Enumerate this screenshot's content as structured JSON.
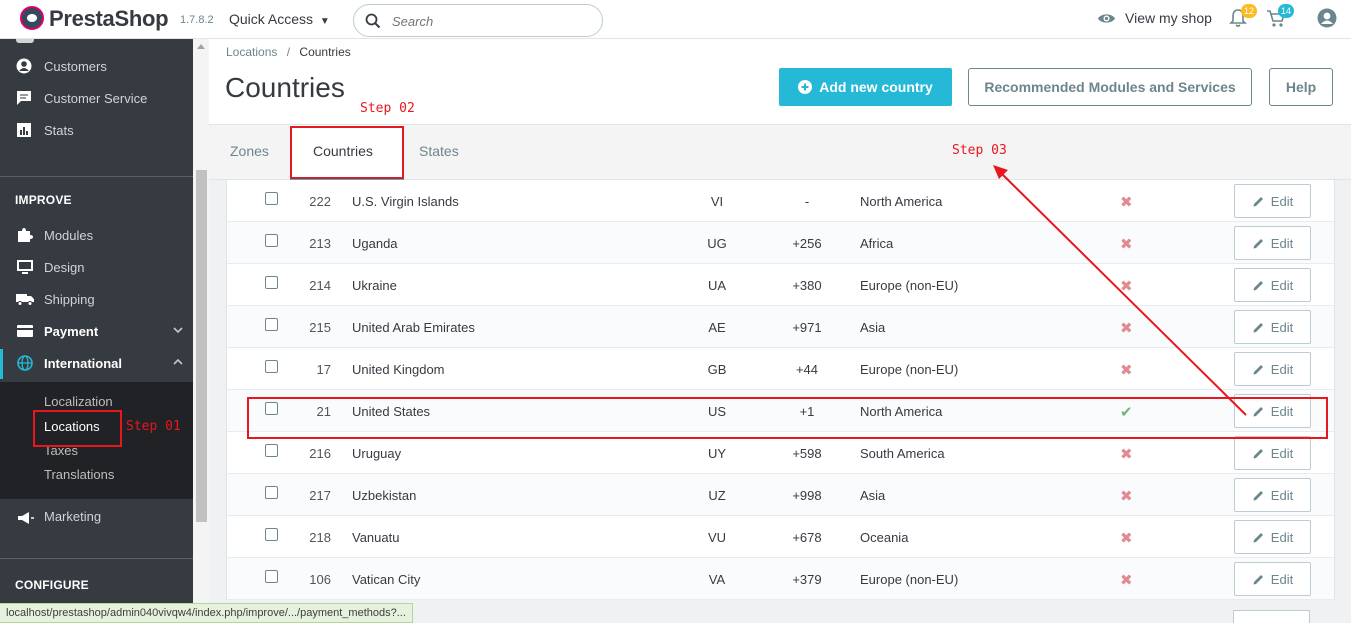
{
  "header": {
    "brand": "PrestaShop",
    "version": "1.7.8.2",
    "quick_access": "Quick Access",
    "search_placeholder": "Search",
    "view_shop": "View my shop",
    "notifications_count": "12",
    "cart_count": "14",
    "colors": {
      "accent": "#25b9d7",
      "badge_orange": "#fbbb22"
    }
  },
  "sidebar": {
    "items_top": [
      {
        "label": "Customers",
        "icon": "customer-icon"
      },
      {
        "label": "Customer Service",
        "icon": "chat-icon"
      },
      {
        "label": "Stats",
        "icon": "stats-icon"
      }
    ],
    "improve_title": "IMPROVE",
    "improve_items": [
      {
        "label": "Modules",
        "icon": "puzzle-icon"
      },
      {
        "label": "Design",
        "icon": "monitor-icon"
      },
      {
        "label": "Shipping",
        "icon": "truck-icon"
      },
      {
        "label": "Payment",
        "icon": "card-icon"
      },
      {
        "label": "International",
        "icon": "globe-icon"
      }
    ],
    "sub_items": [
      "Localization",
      "Locations",
      "Taxes",
      "Translations"
    ],
    "marketing": "Marketing",
    "configure_title": "CONFIGURE"
  },
  "page": {
    "breadcrumb_parent": "Locations",
    "breadcrumb_sep": "/",
    "breadcrumb_current": "Countries",
    "title": "Countries",
    "add_button": "Add new country",
    "recommended_button": "Recommended Modules and Services",
    "help_button": "Help"
  },
  "tabs": [
    "Zones",
    "Countries",
    "States"
  ],
  "table": {
    "edit_label": "Edit",
    "rows": [
      {
        "id": "222",
        "name": "U.S. Virgin Islands",
        "iso": "VI",
        "call": "-",
        "zone": "North America",
        "enabled": false
      },
      {
        "id": "213",
        "name": "Uganda",
        "iso": "UG",
        "call": "+256",
        "zone": "Africa",
        "enabled": false
      },
      {
        "id": "214",
        "name": "Ukraine",
        "iso": "UA",
        "call": "+380",
        "zone": "Europe (non-EU)",
        "enabled": false
      },
      {
        "id": "215",
        "name": "United Arab Emirates",
        "iso": "AE",
        "call": "+971",
        "zone": "Asia",
        "enabled": false
      },
      {
        "id": "17",
        "name": "United Kingdom",
        "iso": "GB",
        "call": "+44",
        "zone": "Europe (non-EU)",
        "enabled": false
      },
      {
        "id": "21",
        "name": "United States",
        "iso": "US",
        "call": "+1",
        "zone": "North America",
        "enabled": true
      },
      {
        "id": "216",
        "name": "Uruguay",
        "iso": "UY",
        "call": "+598",
        "zone": "South America",
        "enabled": false
      },
      {
        "id": "217",
        "name": "Uzbekistan",
        "iso": "UZ",
        "call": "+998",
        "zone": "Asia",
        "enabled": false
      },
      {
        "id": "218",
        "name": "Vanuatu",
        "iso": "VU",
        "call": "+678",
        "zone": "Oceania",
        "enabled": false
      },
      {
        "id": "106",
        "name": "Vatican City",
        "iso": "VA",
        "call": "+379",
        "zone": "Europe (non-EU)",
        "enabled": false
      }
    ]
  },
  "annotations": {
    "step1": "Step 01",
    "step2": "Step 02",
    "step3": "Step 03",
    "color": "#e8171d"
  },
  "statusbar": "localhost/prestashop/admin040vivqw4/index.php/improve/.../payment_methods?..."
}
